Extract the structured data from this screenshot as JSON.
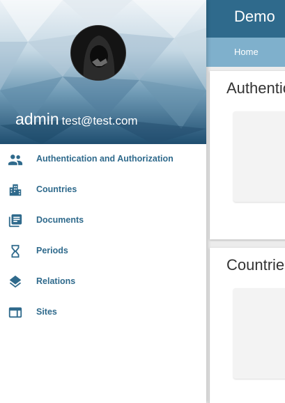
{
  "app": {
    "title": "Demo"
  },
  "nav": {
    "home_label": "Home"
  },
  "cards": [
    {
      "title": "Authentication and Authorization"
    },
    {
      "title": "Countries"
    }
  ],
  "user": {
    "name": "admin",
    "email": "test@test.com"
  },
  "menu": {
    "items": [
      {
        "label": "Authentication and Authorization",
        "icon": "people-icon"
      },
      {
        "label": "Countries",
        "icon": "city-icon"
      },
      {
        "label": "Documents",
        "icon": "library-books-icon"
      },
      {
        "label": "Periods",
        "icon": "hourglass-icon"
      },
      {
        "label": "Relations",
        "icon": "layers-icon"
      },
      {
        "label": "Sites",
        "icon": "web-window-icon"
      }
    ]
  },
  "colors": {
    "primary": "#2f6a8c",
    "nav": "#7fb0cc",
    "menu_text": "#2f6a8c",
    "icon": "#2f6a8c"
  }
}
